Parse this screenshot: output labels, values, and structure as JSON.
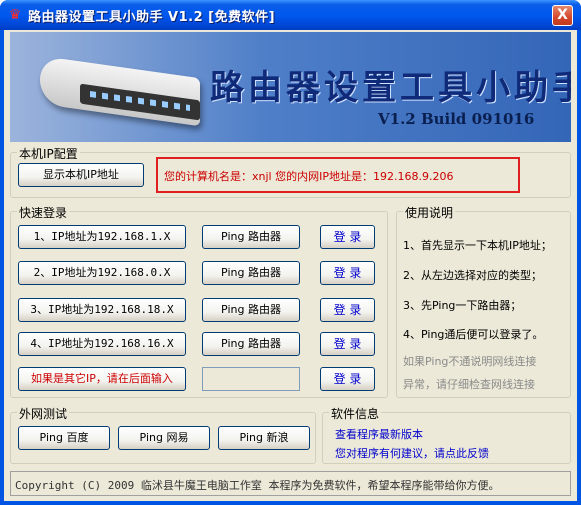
{
  "window": {
    "title": "路由器设置工具小助手 V1.2 [免费软件]",
    "close_label": "X"
  },
  "banner": {
    "title": "路由器设置工具小助手",
    "version": "V1.2 Build 091016"
  },
  "local_ip": {
    "legend": "本机IP配置",
    "show_button": "显示本机IP地址",
    "info_text": "您的计算机名是：xnjl  您的内网IP地址是：192.168.9.206"
  },
  "quick_login": {
    "legend": "快速登录",
    "rows": [
      {
        "ip_button": "1、IP地址为192.168.1.X",
        "ping_button": "Ping 路由器",
        "login_button": "登 录"
      },
      {
        "ip_button": "2、IP地址为192.168.0.X",
        "ping_button": "Ping 路由器",
        "login_button": "登 录"
      },
      {
        "ip_button": "3、IP地址为192.168.18.X",
        "ping_button": "Ping 路由器",
        "login_button": "登 录"
      },
      {
        "ip_button": "4、IP地址为192.168.16.X",
        "ping_button": "Ping 路由器",
        "login_button": "登 录"
      }
    ],
    "other_ip_button": "如果是其它IP，请在后面输入",
    "other_login_button": "登 录"
  },
  "usage": {
    "legend": "使用说明",
    "lines": [
      "1、首先显示一下本机IP地址；",
      "2、从左边选择对应的类型；",
      "3、先Ping一下路由器；",
      "4、Ping通后便可以登录了。"
    ],
    "note_lines": [
      "如果Ping不通说明网线连接",
      "异常，请仔细检查网线连接"
    ]
  },
  "external": {
    "legend": "外网测试",
    "buttons": [
      "Ping 百度",
      "Ping 网易",
      "Ping 新浪"
    ]
  },
  "software_info": {
    "legend": "软件信息",
    "links": [
      "查看程序最新版本",
      "您对程序有何建议，请点此反馈"
    ]
  },
  "status": "Copyright (C) 2009 临沭县牛魔王电脑工作室  本程序为免费软件，希望本程序能带给你方便。"
}
